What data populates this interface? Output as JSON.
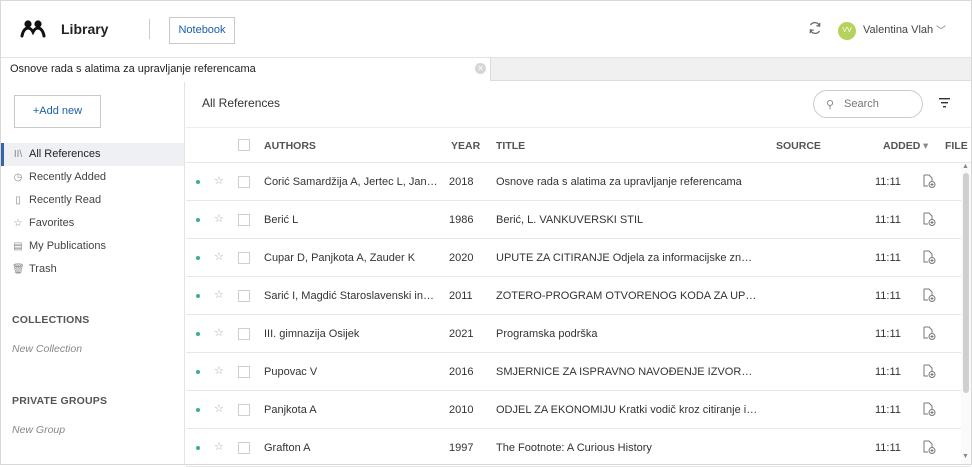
{
  "header": {
    "app_title": "Library",
    "notebook_label": "Notebook",
    "user": {
      "initials": "VV",
      "name": "Valentina Vlah",
      "avatar_color": "#b7d25b"
    }
  },
  "tabstrip": {
    "open_doc": "Osnove rada s alatima za upravljanje referencama"
  },
  "sidebar": {
    "add_new": "+Add new",
    "items": [
      {
        "label": "All References",
        "icon": "library-icon",
        "glyph": "II\\",
        "active": true
      },
      {
        "label": "Recently Added",
        "icon": "clock-icon",
        "glyph": "◷"
      },
      {
        "label": "Recently Read",
        "icon": "bookmark-icon",
        "glyph": "▯"
      },
      {
        "label": "Favorites",
        "icon": "star-icon",
        "glyph": "☆"
      },
      {
        "label": "My Publications",
        "icon": "publication-icon",
        "glyph": "▤"
      },
      {
        "label": "Trash",
        "icon": "trash-icon",
        "glyph": "🗑"
      }
    ],
    "collections_heading": "COLLECTIONS",
    "new_collection": "New Collection",
    "groups_heading": "PRIVATE GROUPS",
    "new_group": "New Group"
  },
  "main": {
    "title": "All References",
    "search_placeholder": "Search",
    "columns": {
      "authors": "AUTHORS",
      "year": "YEAR",
      "title": "TITLE",
      "source": "SOURCE",
      "added": "ADDED",
      "added_sort": "▾",
      "file": "FILE"
    },
    "accent_color": "#3465a4",
    "unread_dot_color": "#3cae8c",
    "rows": [
      {
        "authors": "Ćorić Samardžija A, Jertec L, Jandrić H",
        "year": "2018",
        "title": " Osnove rada s alatima za upravljanje referencama",
        "source": "",
        "added": "11:11"
      },
      {
        "authors": "Berić L",
        "year": "1986",
        "title": "Berić, L. VANKUVERSKI STIL",
        "source": "",
        "added": "11:11"
      },
      {
        "authors": "Cupar D, Panjkota A, Zauder K",
        "year": "2020",
        "title": "UPUTE ZA CITIRANJE Odjela za informacijske znanosti",
        "source": "",
        "added": "11:11"
      },
      {
        "authors": "Sarić I, Magdić Staroslavenski institut",
        "year": "2011",
        "title": " ZOTERO-PROGRAM OTVORENOG KODA ZA UPRAVLJANJE",
        "source": "",
        "added": "11:11"
      },
      {
        "authors": "III. gimnazija Osijek",
        "year": "2021",
        "title": "Programska podrška",
        "source": "",
        "added": "11:11"
      },
      {
        "authors": "Pupovac V",
        "year": "2016",
        "title": "SMJERNICE ZA ISPRAVNO NAVOĐENJE IZVORA I LITERATURE",
        "source": "",
        "added": "11:11"
      },
      {
        "authors": "Panjkota A",
        "year": "2010",
        "title": "ODJEL ZA EKONOMIJU Kratki vodič kroz citiranje i referenciranje",
        "source": "",
        "added": "11:11"
      },
      {
        "authors": "Grafton A",
        "year": "1997",
        "title": "The Footnote: A Curious History",
        "source": "",
        "added": "11:11"
      }
    ]
  }
}
